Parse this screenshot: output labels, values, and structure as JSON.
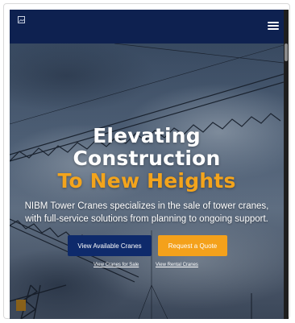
{
  "navbar": {
    "logo_icon": "broken-image-icon",
    "menu_icon": "hamburger-menu-icon"
  },
  "hero": {
    "heading_line1": "Elevating",
    "heading_line2": "Construction",
    "heading_line3": "To New Heights",
    "description": "NIBM Tower Cranes specializes in the sale of tower cranes, with full-service solutions from planning to ongoing support.",
    "primary_button": "View Available Cranes",
    "quote_button": "Request a Quote",
    "link_sale": "View Cranes for Sale",
    "link_rental": "View Rental Cranes"
  },
  "colors": {
    "navbar": "#0e2150",
    "accent": "#f4a11b",
    "primary_button": "#0e2a6b"
  }
}
